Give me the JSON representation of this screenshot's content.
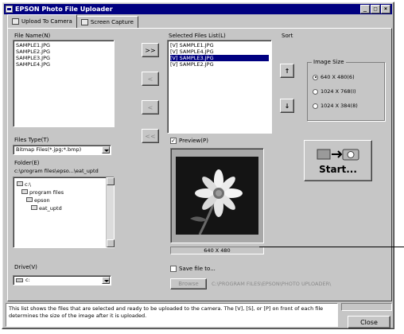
{
  "window": {
    "title": "EPSON Photo File Uploader"
  },
  "titlebar_buttons": {
    "minimize": "_",
    "maximize": "□",
    "close": "×"
  },
  "tabs": [
    {
      "label": "Upload To Camera",
      "icon": "camera-icon"
    },
    {
      "label": "Screen Capture",
      "icon": "screen-icon"
    }
  ],
  "file_names": {
    "label": "File Name(N)",
    "items": [
      "SAMPLE1.JPG",
      "SAMPLE2.JPG",
      "SAMPLE3.JPG",
      "SAMPLE4.JPG"
    ]
  },
  "transfer_buttons": {
    "add": ">>",
    "b2": "<",
    "b3": "<",
    "remove_all": "<<"
  },
  "selected_files": {
    "label": "Selected Files List(L)",
    "items": [
      "[V] SAMPLE1.JPG",
      "[V] SAMPLE4.JPG",
      "[V] SAMPLE3.JPG",
      "[V] SAMPLE2.JPG"
    ],
    "selected_index": 2
  },
  "sort": {
    "label": "Sort",
    "up": "↑",
    "down": "↓"
  },
  "image_size": {
    "label": "Image Size",
    "options": [
      "640 X 480(6)",
      "1024 X 768(I)",
      "1024 X 384(8)"
    ],
    "selected_index": 0
  },
  "files_type": {
    "label": "Files Type(T)",
    "value": "Bitmap Files(*.jpg;*.bmp)"
  },
  "folder": {
    "label": "Folder(E)",
    "path": "c:\\program files\\epso...\\eat_uptd",
    "tree": [
      "c:\\",
      "program files",
      "epson",
      "eat_uptd"
    ]
  },
  "drive": {
    "label": "Drive(V)",
    "value": "c:"
  },
  "preview": {
    "label": "Preview(P)",
    "checked": true,
    "size_text": "640 X 480"
  },
  "start": {
    "label": "Start..."
  },
  "save_file": {
    "label": "Save file to...",
    "checked": false,
    "button": "Browse",
    "path": "C:\\PROGRAM FILES\\EPSON\\PHOTO UPLOADER\\"
  },
  "description": "This list shows the files that are selected and ready to be uploaded to the camera. The [V], [S], or [P] on front of each file determines the size of the image after it is uploaded.",
  "close_button": "Close",
  "colors": {
    "title_bg": "#000080",
    "face": "#c6c6c6",
    "selection": "#000080"
  }
}
